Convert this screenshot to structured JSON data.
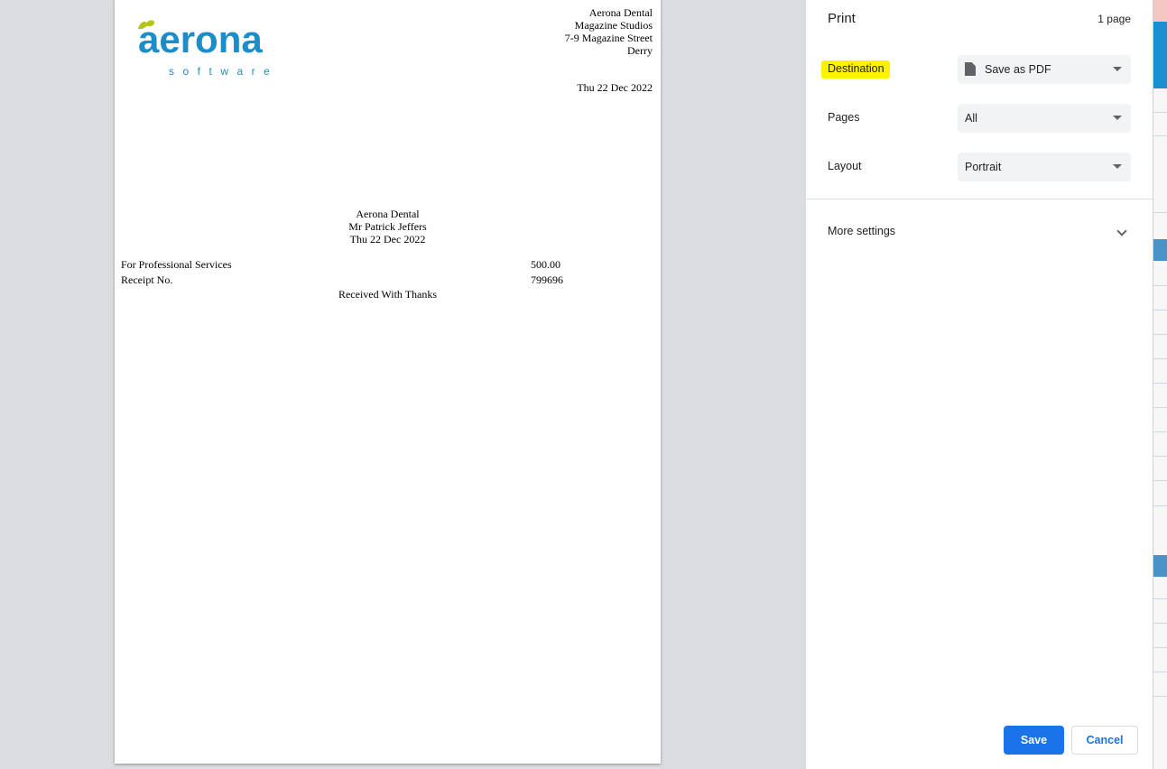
{
  "preview": {
    "logo": {
      "wordmark": "aerona",
      "subtitle": "software"
    },
    "address_lines": [
      "Aerona Dental",
      "Magazine Studios",
      "7-9 Magazine Street",
      "Derry"
    ],
    "header_date": "Thu 22 Dec 2022",
    "center_lines": [
      "Aerona Dental",
      "Mr Patrick Jeffers",
      "Thu 22 Dec 2022"
    ],
    "rows": [
      {
        "label": "For Professional Services",
        "value": "500.00"
      },
      {
        "label": "Receipt No.",
        "value": "799696"
      }
    ],
    "footer_text": "Received With Thanks"
  },
  "panel": {
    "title": "Print",
    "page_count": "1 page",
    "settings": {
      "destination": {
        "label": "Destination",
        "value": "Save as PDF",
        "icon": "document-icon"
      },
      "pages": {
        "label": "Pages",
        "value": "All"
      },
      "layout": {
        "label": "Layout",
        "value": "Portrait"
      }
    },
    "more_settings": "More settings",
    "save_label": "Save",
    "cancel_label": "Cancel",
    "colors": {
      "accent": "#1a73e8",
      "highlight": "#fff200",
      "logo": "#1b8dc8",
      "leaf": "#b5c21a"
    }
  }
}
